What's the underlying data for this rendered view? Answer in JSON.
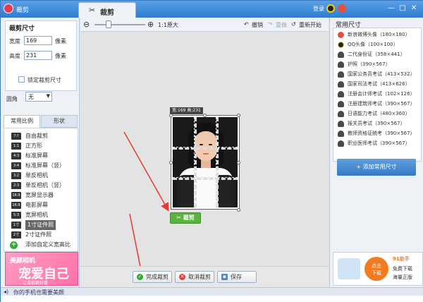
{
  "titlebar": {
    "app_title": "裁剪",
    "tab_label": "裁剪",
    "login": "登录",
    "min": "—",
    "max": "□",
    "close": "✕"
  },
  "left": {
    "crop_size_title": "裁剪尺寸",
    "width_label": "宽度",
    "width_value": "169",
    "height_label": "高度",
    "height_value": "231",
    "unit": "像素",
    "lock_label": "锁定裁剪尺寸",
    "round_label": "圆角",
    "round_value": "无",
    "tabs": [
      "常用比例",
      "形状"
    ],
    "ratios": [
      {
        "icon": "?:?",
        "label": "自由裁剪"
      },
      {
        "icon": "1:1",
        "label": "正方形"
      },
      {
        "icon": "4:3",
        "label": "标准屏幕"
      },
      {
        "icon": "3:4",
        "label": "标准屏幕（竖）"
      },
      {
        "icon": "3:2",
        "label": "单反相机"
      },
      {
        "icon": "2:3",
        "label": "单反相机（竖）"
      },
      {
        "icon": "16:9",
        "label": "宽屏显示器"
      },
      {
        "icon": "16:9",
        "label": "电影屏幕"
      },
      {
        "icon": "5:3",
        "label": "宽屏相机"
      },
      {
        "icon": "1寸",
        "label": "1寸证件照"
      },
      {
        "icon": "2寸",
        "label": "2寸证件照"
      }
    ],
    "add_custom": "添加自定义宽高比",
    "ad": {
      "brand": "美颜相机",
      "headline": "宠爱自己",
      "sub": "让自拍更好看"
    }
  },
  "toolbar": {
    "zoom_label": "1:1原大",
    "undo": "撤销",
    "redo": "重做",
    "restart": "重新开始"
  },
  "canvas": {
    "size_tag": "宽:169 高:231",
    "crop_button": "裁剪"
  },
  "bottom": {
    "done": "完成裁剪",
    "cancel": "取消裁剪",
    "save": "保存"
  },
  "right": {
    "title": "常用尺寸",
    "sizes": [
      {
        "icon": "weibo",
        "label": "新浪微博头像（180×180）"
      },
      {
        "icon": "qq",
        "label": "QQ头像（100×100）"
      },
      {
        "icon": "person",
        "label": "二代身份证（358×441）"
      },
      {
        "icon": "person",
        "label": "护照（390×567）"
      },
      {
        "icon": "person",
        "label": "国家公务员考试（413×532）"
      },
      {
        "icon": "person",
        "label": "国家司法考试（413×626）"
      },
      {
        "icon": "person",
        "label": "注册会计师考试（102×126）"
      },
      {
        "icon": "person",
        "label": "注册建筑师考试（390×567）"
      },
      {
        "icon": "person",
        "label": "日语能力考试（480×360）"
      },
      {
        "icon": "person",
        "label": "报关员考试（390×567）"
      },
      {
        "icon": "person",
        "label": "教师资格证统考（390×567）"
      },
      {
        "icon": "person",
        "label": "职业医师考试（390×567）"
      }
    ],
    "add_button": "+ 添加常用尺寸",
    "ad": {
      "circle_line1": "点击",
      "circle_line2": "下载",
      "brand": "91助手",
      "line1": "免费下载",
      "line2": "海量正版"
    }
  },
  "status": {
    "text": "你的手机也需要美颜"
  },
  "colors": {
    "titlebar": "#2f7ccf",
    "crop_green": "#58b43a",
    "arrow_red": "#e53935",
    "add_blue": "#3479c4"
  }
}
